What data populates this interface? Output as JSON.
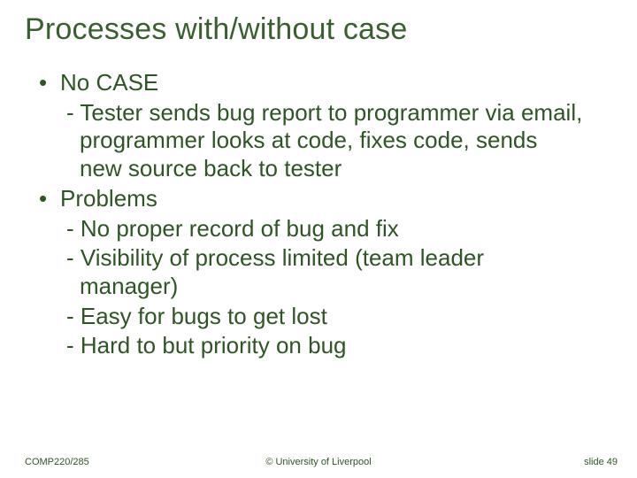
{
  "title": "Processes with/without case",
  "bullets": {
    "b1": "No CASE",
    "b1a": "- Tester sends bug report to programmer via email, programmer looks at code, fixes code, sends new source back to tester",
    "b2": "Problems",
    "b2a": "- No proper record of bug and fix",
    "b2b": "- Visibility of process limited (team leader manager)",
    "b2c": "- Easy for bugs to get lost",
    "b2d": "- Hard to but priority on bug"
  },
  "footer": {
    "left": "COMP220/285",
    "center": "© University of Liverpool",
    "right": "slide  49"
  }
}
